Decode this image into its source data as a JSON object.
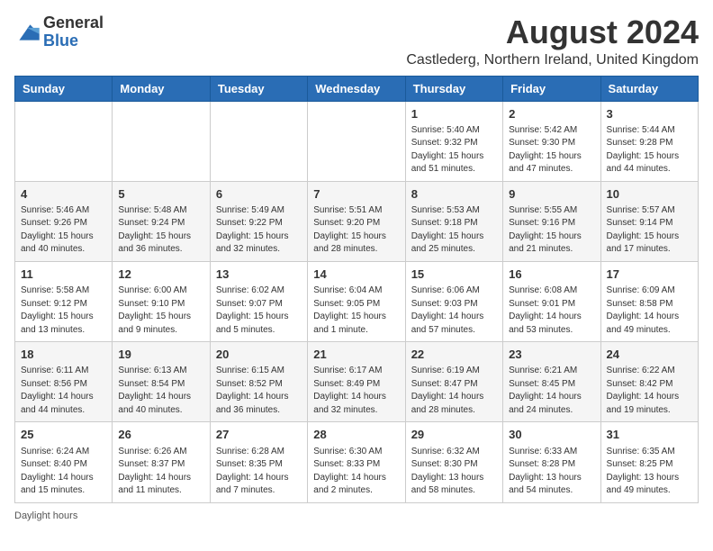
{
  "logo": {
    "general": "General",
    "blue": "Blue"
  },
  "title": "August 2024",
  "subtitle": "Castlederg, Northern Ireland, United Kingdom",
  "footer": "Daylight hours",
  "weekdays": [
    "Sunday",
    "Monday",
    "Tuesday",
    "Wednesday",
    "Thursday",
    "Friday",
    "Saturday"
  ],
  "weeks": [
    [
      {
        "day": "",
        "info": ""
      },
      {
        "day": "",
        "info": ""
      },
      {
        "day": "",
        "info": ""
      },
      {
        "day": "",
        "info": ""
      },
      {
        "day": "1",
        "info": "Sunrise: 5:40 AM\nSunset: 9:32 PM\nDaylight: 15 hours\nand 51 minutes."
      },
      {
        "day": "2",
        "info": "Sunrise: 5:42 AM\nSunset: 9:30 PM\nDaylight: 15 hours\nand 47 minutes."
      },
      {
        "day": "3",
        "info": "Sunrise: 5:44 AM\nSunset: 9:28 PM\nDaylight: 15 hours\nand 44 minutes."
      }
    ],
    [
      {
        "day": "4",
        "info": "Sunrise: 5:46 AM\nSunset: 9:26 PM\nDaylight: 15 hours\nand 40 minutes."
      },
      {
        "day": "5",
        "info": "Sunrise: 5:48 AM\nSunset: 9:24 PM\nDaylight: 15 hours\nand 36 minutes."
      },
      {
        "day": "6",
        "info": "Sunrise: 5:49 AM\nSunset: 9:22 PM\nDaylight: 15 hours\nand 32 minutes."
      },
      {
        "day": "7",
        "info": "Sunrise: 5:51 AM\nSunset: 9:20 PM\nDaylight: 15 hours\nand 28 minutes."
      },
      {
        "day": "8",
        "info": "Sunrise: 5:53 AM\nSunset: 9:18 PM\nDaylight: 15 hours\nand 25 minutes."
      },
      {
        "day": "9",
        "info": "Sunrise: 5:55 AM\nSunset: 9:16 PM\nDaylight: 15 hours\nand 21 minutes."
      },
      {
        "day": "10",
        "info": "Sunrise: 5:57 AM\nSunset: 9:14 PM\nDaylight: 15 hours\nand 17 minutes."
      }
    ],
    [
      {
        "day": "11",
        "info": "Sunrise: 5:58 AM\nSunset: 9:12 PM\nDaylight: 15 hours\nand 13 minutes."
      },
      {
        "day": "12",
        "info": "Sunrise: 6:00 AM\nSunset: 9:10 PM\nDaylight: 15 hours\nand 9 minutes."
      },
      {
        "day": "13",
        "info": "Sunrise: 6:02 AM\nSunset: 9:07 PM\nDaylight: 15 hours\nand 5 minutes."
      },
      {
        "day": "14",
        "info": "Sunrise: 6:04 AM\nSunset: 9:05 PM\nDaylight: 15 hours\nand 1 minute."
      },
      {
        "day": "15",
        "info": "Sunrise: 6:06 AM\nSunset: 9:03 PM\nDaylight: 14 hours\nand 57 minutes."
      },
      {
        "day": "16",
        "info": "Sunrise: 6:08 AM\nSunset: 9:01 PM\nDaylight: 14 hours\nand 53 minutes."
      },
      {
        "day": "17",
        "info": "Sunrise: 6:09 AM\nSunset: 8:58 PM\nDaylight: 14 hours\nand 49 minutes."
      }
    ],
    [
      {
        "day": "18",
        "info": "Sunrise: 6:11 AM\nSunset: 8:56 PM\nDaylight: 14 hours\nand 44 minutes."
      },
      {
        "day": "19",
        "info": "Sunrise: 6:13 AM\nSunset: 8:54 PM\nDaylight: 14 hours\nand 40 minutes."
      },
      {
        "day": "20",
        "info": "Sunrise: 6:15 AM\nSunset: 8:52 PM\nDaylight: 14 hours\nand 36 minutes."
      },
      {
        "day": "21",
        "info": "Sunrise: 6:17 AM\nSunset: 8:49 PM\nDaylight: 14 hours\nand 32 minutes."
      },
      {
        "day": "22",
        "info": "Sunrise: 6:19 AM\nSunset: 8:47 PM\nDaylight: 14 hours\nand 28 minutes."
      },
      {
        "day": "23",
        "info": "Sunrise: 6:21 AM\nSunset: 8:45 PM\nDaylight: 14 hours\nand 24 minutes."
      },
      {
        "day": "24",
        "info": "Sunrise: 6:22 AM\nSunset: 8:42 PM\nDaylight: 14 hours\nand 19 minutes."
      }
    ],
    [
      {
        "day": "25",
        "info": "Sunrise: 6:24 AM\nSunset: 8:40 PM\nDaylight: 14 hours\nand 15 minutes."
      },
      {
        "day": "26",
        "info": "Sunrise: 6:26 AM\nSunset: 8:37 PM\nDaylight: 14 hours\nand 11 minutes."
      },
      {
        "day": "27",
        "info": "Sunrise: 6:28 AM\nSunset: 8:35 PM\nDaylight: 14 hours\nand 7 minutes."
      },
      {
        "day": "28",
        "info": "Sunrise: 6:30 AM\nSunset: 8:33 PM\nDaylight: 14 hours\nand 2 minutes."
      },
      {
        "day": "29",
        "info": "Sunrise: 6:32 AM\nSunset: 8:30 PM\nDaylight: 13 hours\nand 58 minutes."
      },
      {
        "day": "30",
        "info": "Sunrise: 6:33 AM\nSunset: 8:28 PM\nDaylight: 13 hours\nand 54 minutes."
      },
      {
        "day": "31",
        "info": "Sunrise: 6:35 AM\nSunset: 8:25 PM\nDaylight: 13 hours\nand 49 minutes."
      }
    ]
  ]
}
